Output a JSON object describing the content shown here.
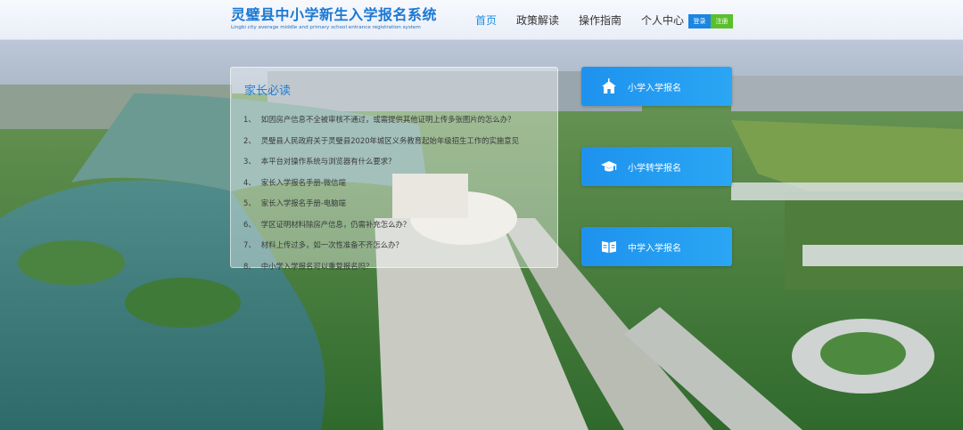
{
  "header": {
    "title": "灵璧县中小学新生入学报名系统",
    "subtitle": "Lingbi city average middle and primary school entrance registration system",
    "nav": [
      {
        "label": "首页",
        "active": true
      },
      {
        "label": "政策解读",
        "active": false
      },
      {
        "label": "操作指南",
        "active": false
      },
      {
        "label": "个人中心",
        "active": false
      }
    ],
    "login_label": "登录",
    "register_label": "注册"
  },
  "notice": {
    "title": "家长必读",
    "items": [
      {
        "num": "1、",
        "text": "如因房产信息不全被审核不通过，或需提供其他证明上传多张图片的怎么办？"
      },
      {
        "num": "2、",
        "text": "灵璧县人民政府关于灵璧县2020年城区义务教育起始年级招生工作的实施意见"
      },
      {
        "num": "3、",
        "text": "本平台对操作系统与浏览器有什么要求？"
      },
      {
        "num": "4、",
        "text": "家长入学报名手册-微信端"
      },
      {
        "num": "5、",
        "text": "家长入学报名手册-电脑端"
      },
      {
        "num": "6、",
        "text": "学区证明材料除房产信息，仍需补充怎么办？"
      },
      {
        "num": "7、",
        "text": "材料上传过多，如一次性准备不齐怎么办？"
      },
      {
        "num": "8、",
        "text": "中小学入学报名可以重复报名吗？"
      }
    ]
  },
  "actions": [
    {
      "label": "小学入学报名",
      "icon": "school-building-icon"
    },
    {
      "label": "小学转学报名",
      "icon": "graduation-cap-icon"
    },
    {
      "label": "中学入学报名",
      "icon": "open-book-icon"
    }
  ],
  "colors": {
    "brand_blue": "#1a78d4",
    "button_blue": "#1e92ee",
    "register_green": "#5bbf2c"
  }
}
